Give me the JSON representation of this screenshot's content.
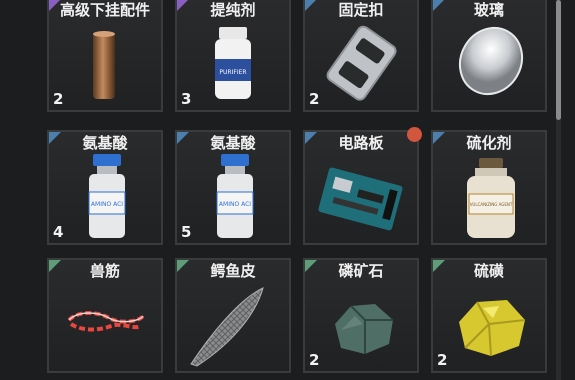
{
  "colors": {
    "purple": "#8a5fc4",
    "blue": "#4a7fae",
    "green": "#5f9c7a"
  },
  "items": [
    {
      "name": "高级下挂配件",
      "count": "2",
      "rarity": "purple",
      "icon": "copper-cylinder-icon"
    },
    {
      "name": "提纯剂",
      "count": "3",
      "rarity": "purple",
      "icon": "purifier-bottle-icon",
      "label": "PURIFIER"
    },
    {
      "name": "固定扣",
      "count": "2",
      "rarity": "blue",
      "icon": "buckle-icon"
    },
    {
      "name": "玻璃",
      "count": "",
      "rarity": "blue",
      "icon": "glass-lens-icon"
    },
    {
      "name": "氨基酸",
      "count": "4",
      "rarity": "blue",
      "icon": "vial-icon",
      "label": "AMINO ACI"
    },
    {
      "name": "氨基酸",
      "count": "5",
      "rarity": "blue",
      "icon": "vial-icon",
      "label": "AMINO ACI"
    },
    {
      "name": "电路板",
      "count": "",
      "rarity": "blue",
      "icon": "circuit-board-icon",
      "badge": true
    },
    {
      "name": "硫化剂",
      "count": "",
      "rarity": "blue",
      "icon": "jar-icon",
      "label": "VULCANIZING AGENT"
    },
    {
      "name": "兽筋",
      "count": "",
      "rarity": "green",
      "icon": "tendon-icon"
    },
    {
      "name": "鳄鱼皮",
      "count": "",
      "rarity": "green",
      "icon": "croc-skin-icon"
    },
    {
      "name": "磷矿石",
      "count": "2",
      "rarity": "green",
      "icon": "ore-rock-icon"
    },
    {
      "name": "硫磺",
      "count": "2",
      "rarity": "green",
      "icon": "sulfur-icon"
    }
  ]
}
